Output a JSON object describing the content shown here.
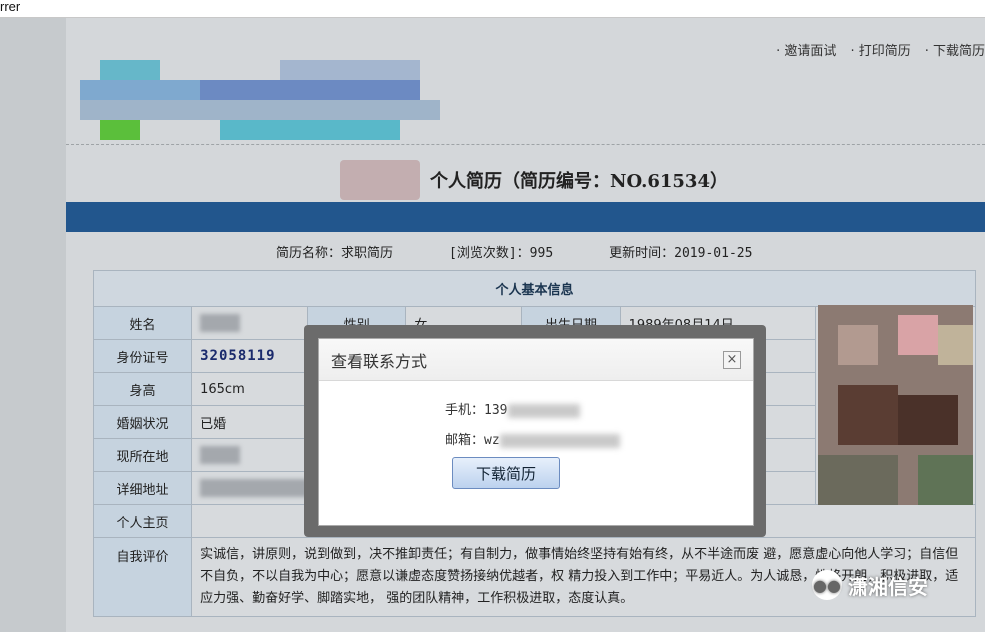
{
  "browser": {
    "fragment": "rrer"
  },
  "toplinks": [
    "邀请面试",
    "打印简历",
    "下载简历"
  ],
  "title": "个人简历（简历编号：NO.61534）",
  "meta": {
    "resume_name": "简历名称：求职简历",
    "views": "[浏览次数]：995",
    "updated": "更新时间：2019-01-25"
  },
  "table": {
    "section": "个人基本信息",
    "labels": {
      "name": "姓名",
      "gender": "性别",
      "birth": "出生日期",
      "id": "身份证号",
      "height": "身高",
      "marital": "婚姻状况",
      "residence": "现所在地",
      "address": "详细地址",
      "homepage": "个人主页",
      "self_eval": "自我评价"
    },
    "values": {
      "gender": "女",
      "birth": "1989年08月14日",
      "id": "32058119",
      "height": "165cm",
      "marital": "已婚",
      "self_eval": "实诚信，讲原则，说到做到，决不推卸责任；有自制力，做事情始终坚持有始有终，从不半途而废 避，愿意虚心向他人学习；自信但不自负，不以自我为中心；愿意以谦虚态度赞扬接纳优越者，权 精力投入到工作中；平易近人。为人诚恳，性格开朗，积极进取，适应力强、勤奋好学、脚踏实地， 强的团队精神，工作积极进取，态度认真。"
    }
  },
  "modal": {
    "title": "查看联系方式",
    "close": "×",
    "phone_label": "手机：",
    "phone_value": "139",
    "email_label": "邮箱：",
    "email_value": "wz",
    "download_label": "下载简历"
  },
  "watermark": {
    "text": "潇湘信安",
    "icon": "wechat-icon"
  },
  "colors": {
    "brand_bar": "#22568d",
    "table_label_bg": "#c6d3df",
    "modal_bg": "#ffffff"
  }
}
